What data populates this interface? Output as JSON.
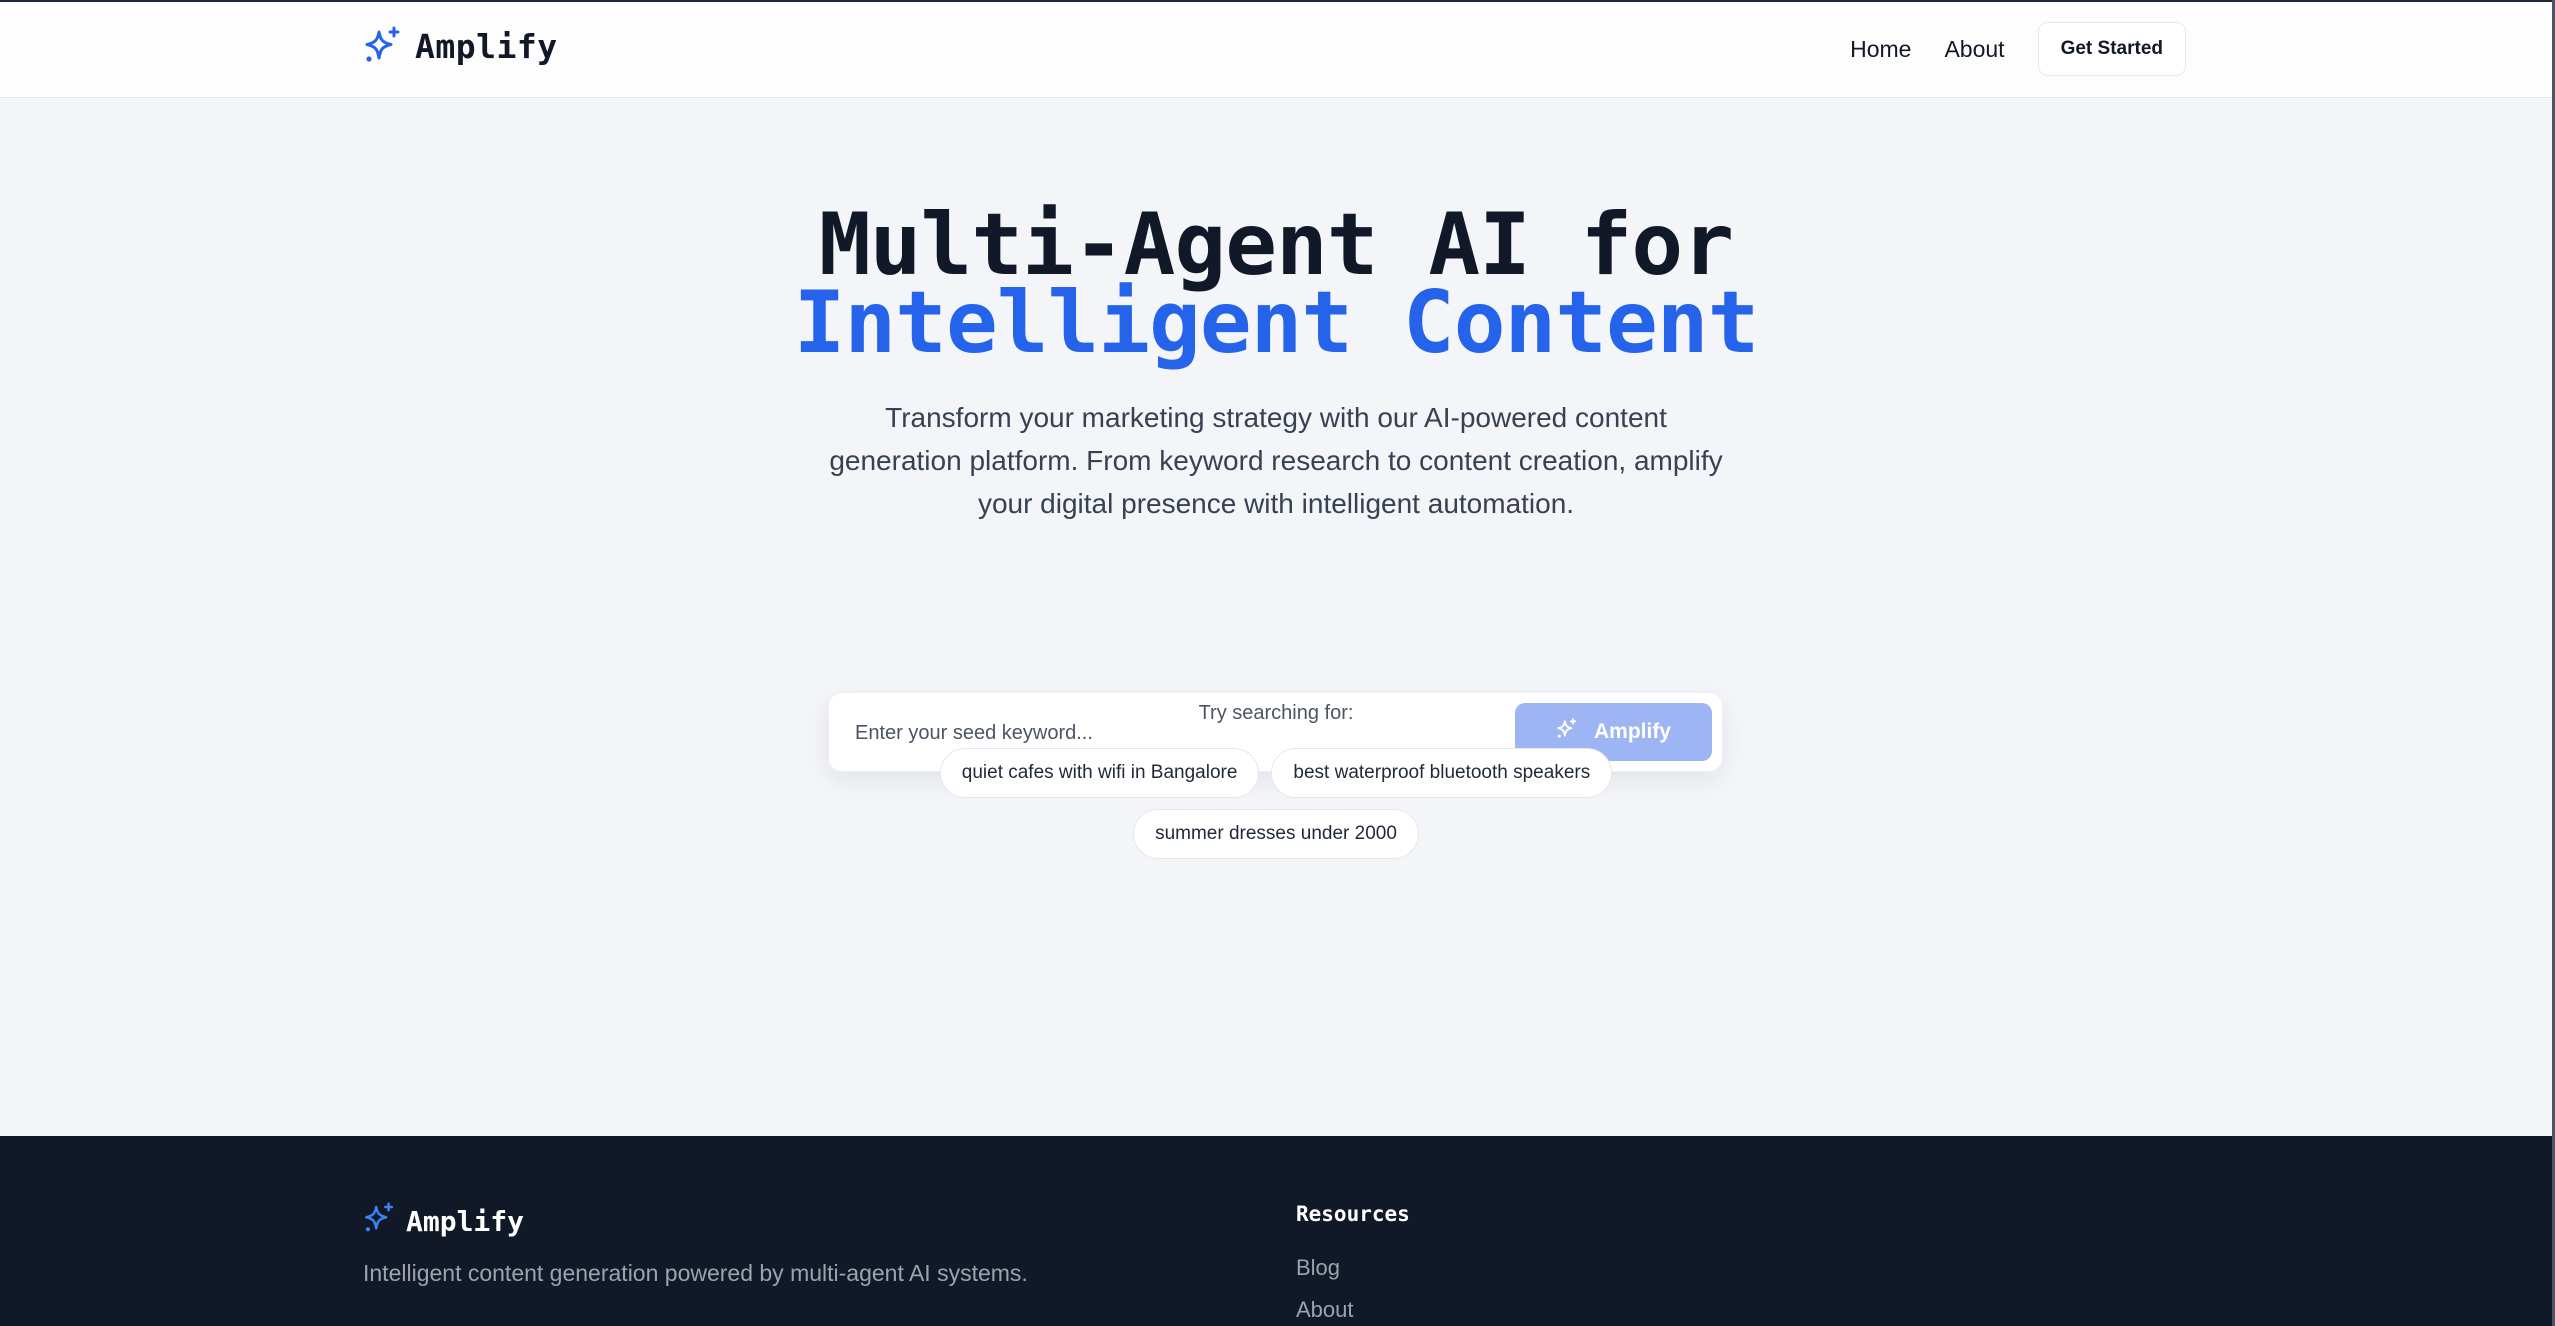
{
  "colors": {
    "primary": "#2563eb",
    "button_disabled": "#9db6f3",
    "text_dark": "#111827",
    "footer_bg": "#111827",
    "page_bg": "#f3f5f9"
  },
  "header": {
    "logo_icon": "sparkles-icon",
    "brand": "Amplify",
    "nav": {
      "home": "Home",
      "about": "About",
      "cta": "Get Started"
    }
  },
  "hero": {
    "title_line1": "Multi-Agent AI for",
    "title_line2": "Intelligent Content",
    "subtitle": "Transform your marketing strategy with our AI-powered content generation platform. From keyword research to content creation, amplify your digital presence with intelligent automation."
  },
  "search": {
    "placeholder": "Enter your seed keyword...",
    "value": "",
    "button_label": "Amplify",
    "button_icon": "sparkles-icon"
  },
  "suggestions": {
    "label": "Try searching for:",
    "items": [
      "quiet cafes with wifi in Bangalore",
      "best waterproof bluetooth speakers",
      "summer dresses under 2000"
    ]
  },
  "footer": {
    "brand": "Amplify",
    "tagline": "Intelligent content generation powered by multi-agent AI systems.",
    "resources_title": "Resources",
    "links": [
      "Blog",
      "About"
    ]
  }
}
